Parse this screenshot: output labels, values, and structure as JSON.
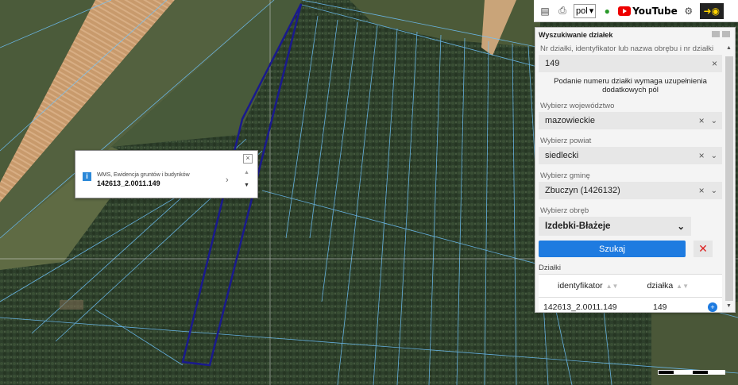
{
  "toolbar": {
    "lang": "pol",
    "youtube": "YouTube",
    "icons": [
      "info-icon",
      "print-icon",
      "language-select",
      "help-icon",
      "youtube-logo",
      "eye-icon"
    ]
  },
  "popup": {
    "layer": "WMS, Ewidencja gruntów i budynków",
    "parcel_id": "142613_2.0011.149"
  },
  "panel": {
    "title": "Wyszukiwanie działek",
    "search_label": "Nr działki, identyfikator lub nazwa obrębu i nr działki",
    "search_value": "149",
    "note": "Podanie numeru działki wymaga uzupełnienia dodatkowych pól",
    "voivodeship_label": "Wybierz województwo",
    "voivodeship_value": "mazowieckie",
    "county_label": "Wybierz powiat",
    "county_value": "siedlecki",
    "commune_label": "Wybierz gminę",
    "commune_value": "Zbuczyn (1426132)",
    "precinct_label": "Wybierz obręb",
    "precinct_value": "Izdebki-Błażeje",
    "search_button": "Szukaj",
    "results_label": "Działki",
    "col_identifier": "identyfikator",
    "col_parcel": "działka",
    "row_identifier": "142613_2.0011.149",
    "row_parcel": "149"
  },
  "colors": {
    "accent": "#1e7be0",
    "parcel_outline": "#1a1a8c",
    "boundary": "#5fb9ff"
  }
}
